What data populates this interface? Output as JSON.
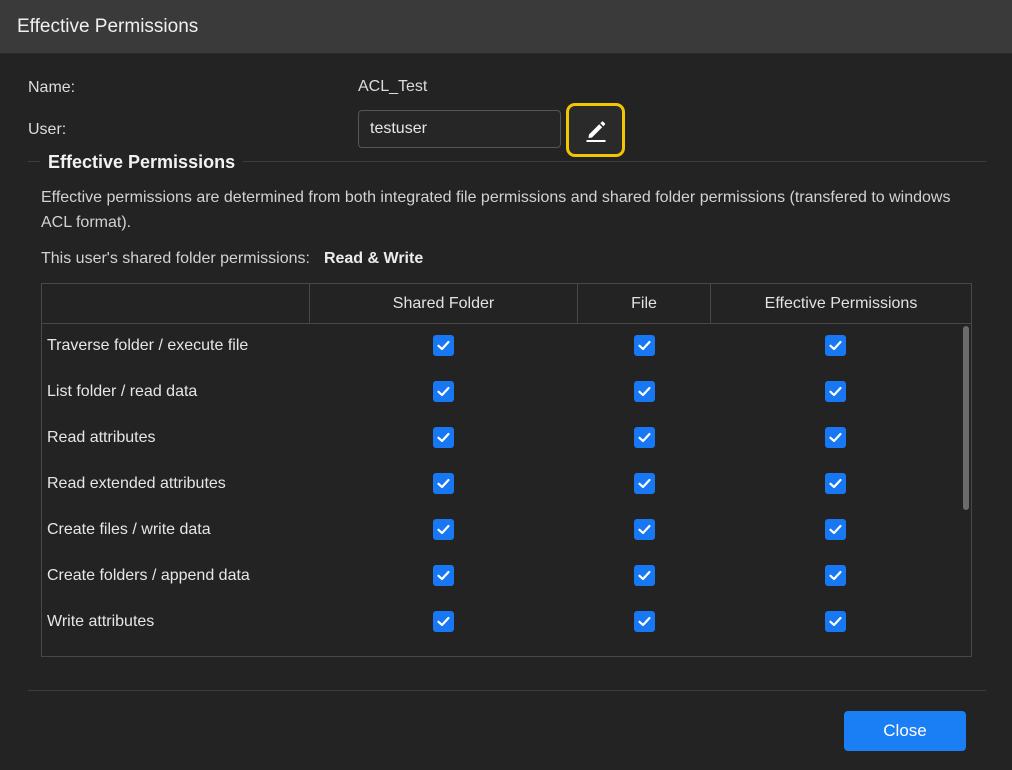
{
  "dialog": {
    "title": "Effective Permissions"
  },
  "fields": {
    "name_label": "Name:",
    "name_value": "ACL_Test",
    "user_label": "User:",
    "user_value": "testuser"
  },
  "section": {
    "title": "Effective Permissions",
    "description": "Effective permissions are determined from both integrated file permissions and shared folder permissions (transfered to windows ACL format).",
    "shared_perm_label": "This user's shared folder permissions:",
    "shared_perm_value": "Read & Write"
  },
  "table": {
    "columns": [
      "",
      "Shared Folder",
      "File",
      "Effective Permissions"
    ],
    "rows": [
      {
        "label": "Traverse folder / execute file",
        "shared_folder": true,
        "file": true,
        "effective": true
      },
      {
        "label": "List folder / read data",
        "shared_folder": true,
        "file": true,
        "effective": true
      },
      {
        "label": "Read attributes",
        "shared_folder": true,
        "file": true,
        "effective": true
      },
      {
        "label": "Read extended attributes",
        "shared_folder": true,
        "file": true,
        "effective": true
      },
      {
        "label": "Create files / write data",
        "shared_folder": true,
        "file": true,
        "effective": true
      },
      {
        "label": "Create folders / append data",
        "shared_folder": true,
        "file": true,
        "effective": true
      },
      {
        "label": "Write attributes",
        "shared_folder": true,
        "file": true,
        "effective": true
      }
    ]
  },
  "icons": {
    "edit": "pencil-icon",
    "check": "checkmark-icon"
  },
  "colors": {
    "accent": "#1877f2",
    "highlight": "#f2c600",
    "background": "#232323",
    "titlebar": "#3a3a3a"
  },
  "footer": {
    "close_label": "Close"
  }
}
